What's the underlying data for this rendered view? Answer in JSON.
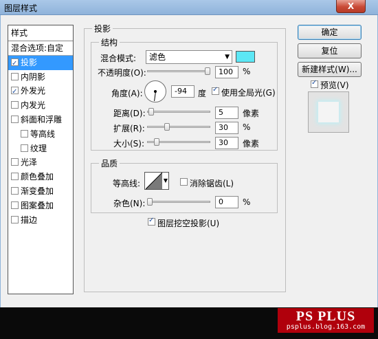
{
  "window": {
    "title": "图层样式",
    "close_label": "X"
  },
  "styles_panel": {
    "header": "样式",
    "items": [
      {
        "label": "混合选项:自定",
        "checkbox": false,
        "checked": false,
        "indent": false,
        "selected": false
      },
      {
        "label": "投影",
        "checkbox": true,
        "checked": true,
        "indent": false,
        "selected": true
      },
      {
        "label": "内阴影",
        "checkbox": true,
        "checked": false,
        "indent": false,
        "selected": false
      },
      {
        "label": "外发光",
        "checkbox": true,
        "checked": true,
        "indent": false,
        "selected": false
      },
      {
        "label": "内发光",
        "checkbox": true,
        "checked": false,
        "indent": false,
        "selected": false
      },
      {
        "label": "斜面和浮雕",
        "checkbox": true,
        "checked": false,
        "indent": false,
        "selected": false
      },
      {
        "label": "等高线",
        "checkbox": true,
        "checked": false,
        "indent": true,
        "selected": false
      },
      {
        "label": "纹理",
        "checkbox": true,
        "checked": false,
        "indent": true,
        "selected": false
      },
      {
        "label": "光泽",
        "checkbox": true,
        "checked": false,
        "indent": false,
        "selected": false
      },
      {
        "label": "颜色叠加",
        "checkbox": true,
        "checked": false,
        "indent": false,
        "selected": false
      },
      {
        "label": "渐变叠加",
        "checkbox": true,
        "checked": false,
        "indent": false,
        "selected": false
      },
      {
        "label": "图案叠加",
        "checkbox": true,
        "checked": false,
        "indent": false,
        "selected": false
      },
      {
        "label": "描边",
        "checkbox": true,
        "checked": false,
        "indent": false,
        "selected": false
      }
    ]
  },
  "drop_shadow": {
    "title": "投影",
    "structure": {
      "title": "结构",
      "blend_mode": {
        "label": "混合模式:",
        "value": "滤色",
        "color": "#5ce7f5"
      },
      "opacity": {
        "label": "不透明度(O):",
        "value": "100",
        "unit": "%",
        "fraction": 1.0
      },
      "angle": {
        "label": "角度(A):",
        "value": "-94",
        "unit": "度",
        "use_global_light": {
          "label": "使用全局光(G)",
          "checked": true
        }
      },
      "distance": {
        "label": "距离(D):",
        "value": "5",
        "unit": "像素",
        "fraction": 0.02
      },
      "spread": {
        "label": "扩展(R):",
        "value": "30",
        "unit": "%",
        "fraction": 0.3
      },
      "size": {
        "label": "大小(S):",
        "value": "30",
        "unit": "像素",
        "fraction": 0.12
      }
    },
    "quality": {
      "title": "品质",
      "contour": {
        "label": "等高线:",
        "anti_aliased": {
          "label": "消除锯齿(L)",
          "checked": false
        }
      },
      "noise": {
        "label": "杂色(N):",
        "value": "0",
        "unit": "%",
        "fraction": 0.0
      }
    },
    "layer_knocks_out": {
      "label": "图层挖空投影(U)",
      "checked": true
    }
  },
  "buttons": {
    "ok": "确定",
    "reset": "复位",
    "new_style": "新建样式(W)...",
    "preview": {
      "label": "预览(V)",
      "checked": true
    }
  },
  "watermark": {
    "line1": "PS PLUS",
    "line2": "psplus.blog.163.com"
  }
}
